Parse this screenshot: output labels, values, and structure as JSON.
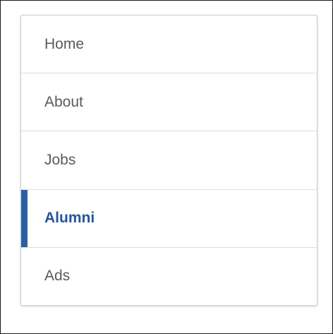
{
  "nav": {
    "items": [
      {
        "label": "Home",
        "active": false
      },
      {
        "label": "About",
        "active": false
      },
      {
        "label": "Jobs",
        "active": false
      },
      {
        "label": "Alumni",
        "active": true
      },
      {
        "label": "Ads",
        "active": false
      }
    ]
  },
  "colors": {
    "active_accent": "#2a5fa6",
    "active_text": "#24559b",
    "text": "#5a5a5a",
    "divider": "#dedede",
    "border": "#cfcfcf"
  }
}
